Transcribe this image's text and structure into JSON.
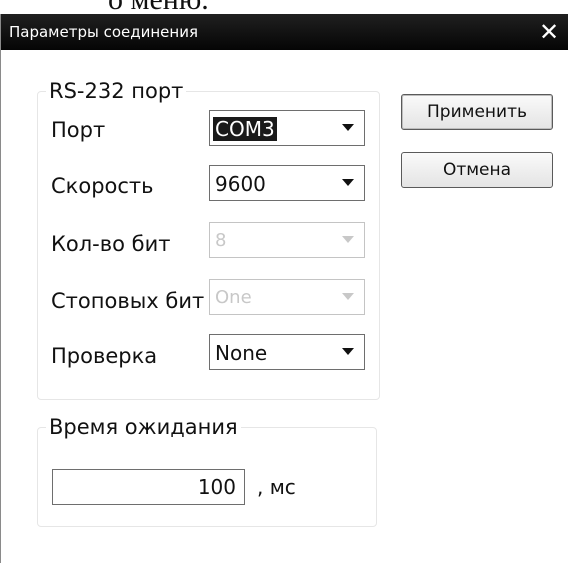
{
  "page_fragment": "о меню.",
  "dialog": {
    "title": "Параметры соединения",
    "close_glyph": "✕"
  },
  "rs232_group": {
    "legend": "RS-232 порт",
    "fields": [
      {
        "label": "Порт",
        "value": "COM3",
        "enabled": true,
        "selected": true
      },
      {
        "label": "Скорость",
        "value": "9600",
        "enabled": true,
        "selected": false
      },
      {
        "label": "Кол-во бит",
        "value": "8",
        "enabled": false,
        "selected": false
      },
      {
        "label": "Стоповых бит",
        "value": "One",
        "enabled": false,
        "selected": false
      },
      {
        "label": "Проверка",
        "value": "None",
        "enabled": true,
        "selected": false
      }
    ]
  },
  "timeout_group": {
    "legend": "Время ожидания",
    "value": "100",
    "unit": ", мс"
  },
  "buttons": {
    "apply": "Применить",
    "cancel": "Отмена"
  },
  "icons": {
    "close": "close-icon",
    "dropdown": "chevron-down-icon"
  },
  "colors": {
    "titlebar": "#0b0b0b",
    "selection": "#1a1a1a",
    "disabled_text": "#c8c8c8"
  }
}
